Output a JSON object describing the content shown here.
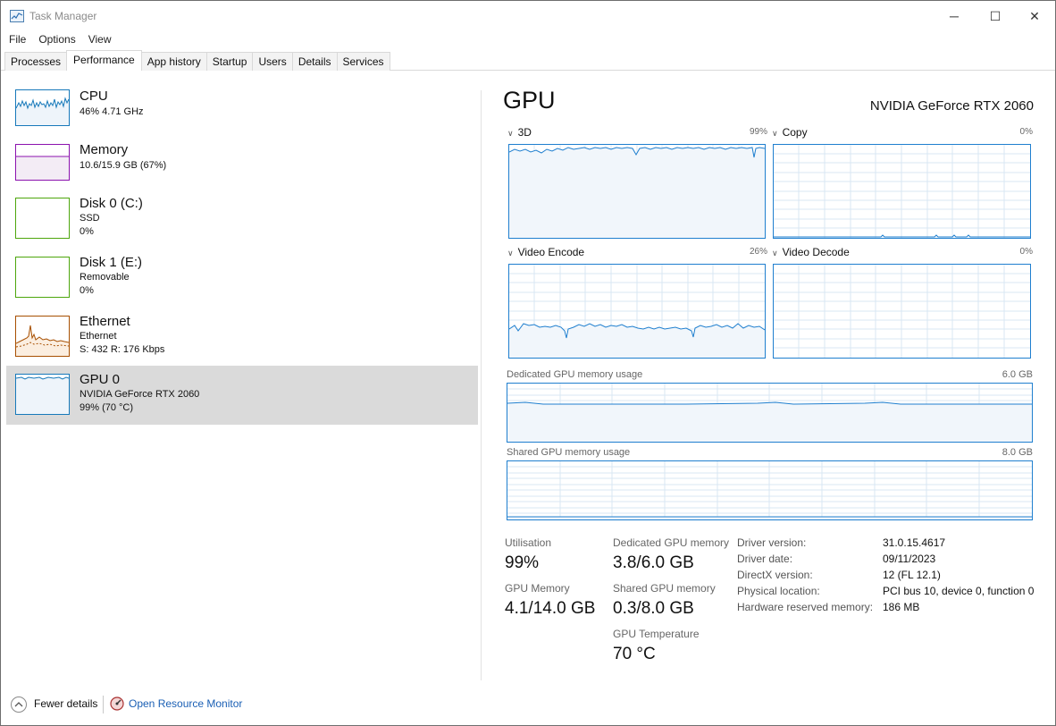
{
  "window": {
    "title": "Task Manager",
    "min_symbol": "─",
    "max_symbol": "☐",
    "close_symbol": "✕"
  },
  "menu": [
    "File",
    "Options",
    "View"
  ],
  "tabs": [
    "Processes",
    "Performance",
    "App history",
    "Startup",
    "Users",
    "Details",
    "Services"
  ],
  "active_tab": "Performance",
  "sidebar": {
    "items": [
      {
        "title": "CPU",
        "line1": "46%  4.71 GHz",
        "line2": "",
        "color": "#1779ba"
      },
      {
        "title": "Memory",
        "line1": "10.6/15.9 GB (67%)",
        "line2": "",
        "color": "#8b12ae"
      },
      {
        "title": "Disk 0 (C:)",
        "line1": "SSD",
        "line2": "0%",
        "color": "#4da60c"
      },
      {
        "title": "Disk 1 (E:)",
        "line1": "Removable",
        "line2": "0%",
        "color": "#4da60c"
      },
      {
        "title": "Ethernet",
        "line1": "Ethernet",
        "line2": "S: 432  R: 176 Kbps",
        "color": "#a74f01"
      },
      {
        "title": "GPU 0",
        "line1": "NVIDIA GeForce RTX 2060",
        "line2": "99%  (70 °C)",
        "color": "#1779ba"
      }
    ],
    "selected_index": 5
  },
  "gpu": {
    "heading": "GPU",
    "name": "NVIDIA GeForce RTX 2060",
    "graphs": [
      {
        "label": "3D",
        "pct": "99%"
      },
      {
        "label": "Copy",
        "pct": "0%"
      },
      {
        "label": "Video Encode",
        "pct": "26%"
      },
      {
        "label": "Video Decode",
        "pct": "0%"
      }
    ],
    "dedicated_label": "Dedicated GPU memory usage",
    "dedicated_max": "6.0 GB",
    "shared_label": "Shared GPU memory usage",
    "shared_max": "8.0 GB",
    "stats": {
      "utilisation_label": "Utilisation",
      "utilisation_value": "99%",
      "gpu_memory_label": "GPU Memory",
      "gpu_memory_value": "4.1/14.0 GB",
      "dedicated_label": "Dedicated GPU memory",
      "dedicated_value": "3.8/6.0 GB",
      "shared_label": "Shared GPU memory",
      "shared_value": "0.3/8.0 GB",
      "temp_label": "GPU Temperature",
      "temp_value": "70 °C"
    },
    "info": [
      {
        "label": "Driver version:",
        "value": "31.0.15.4617"
      },
      {
        "label": "Driver date:",
        "value": "09/11/2023"
      },
      {
        "label": "DirectX version:",
        "value": "12 (FL 12.1)"
      },
      {
        "label": "Physical location:",
        "value": "PCI bus 10, device 0, function 0"
      },
      {
        "label": "Hardware reserved memory:",
        "value": "186 MB"
      }
    ]
  },
  "footer": {
    "fewer_details": "Fewer details",
    "resource_monitor": "Open Resource Monitor"
  },
  "colors": {
    "gpu_line": "#1f7fcf",
    "gpu_fill": "#f1f6fb",
    "grid": "#d9e7f3",
    "link": "#1a5fb4"
  }
}
